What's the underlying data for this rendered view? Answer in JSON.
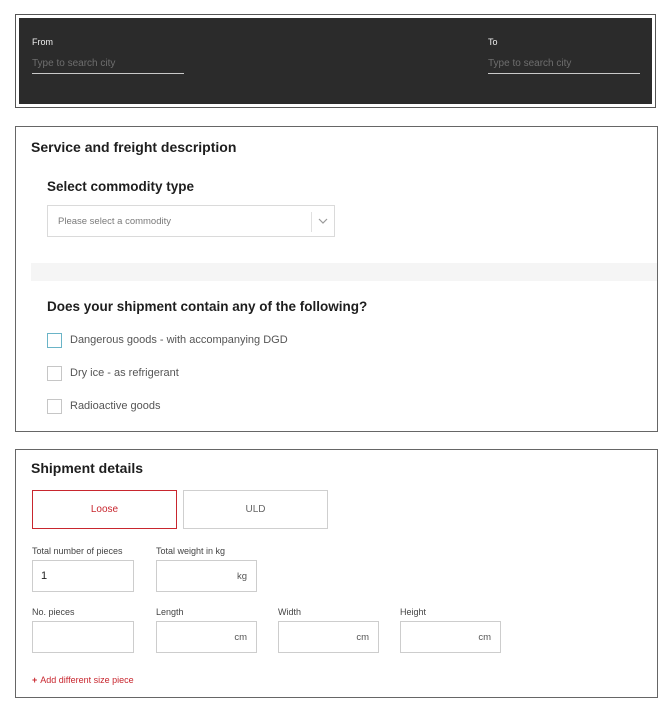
{
  "route": {
    "from_label": "From",
    "from_placeholder": "Type to search city",
    "to_label": "To",
    "to_placeholder": "Type to search city"
  },
  "service": {
    "title": "Service and freight description",
    "commodity_heading": "Select commodity type",
    "commodity_placeholder": "Please select a commodity",
    "commodity_icon": "chevron-down-icon",
    "goods_heading": "Does your shipment contain any of the following?",
    "options": [
      {
        "label": "Dangerous goods - with accompanying DGD",
        "checked": false
      },
      {
        "label": "Dry ice - as refrigerant",
        "checked": false
      },
      {
        "label": "Radioactive goods",
        "checked": false
      }
    ]
  },
  "shipment": {
    "title": "Shipment details",
    "tabs": {
      "loose": "Loose",
      "uld": "ULD",
      "selected": "Loose"
    },
    "total_pieces_label": "Total number of pieces",
    "total_pieces_value": "1",
    "total_weight_label": "Total weight in kg",
    "total_weight_unit": "kg",
    "no_pieces_label": "No. pieces",
    "length_label": "Length",
    "width_label": "Width",
    "height_label": "Height",
    "dim_unit": "cm",
    "add_piece_icon": "+",
    "add_piece_label": "Add different size piece"
  },
  "colors": {
    "accent": "#c8262e",
    "dark_panel": "#2b2b2b",
    "focus": "#6ab4c7"
  }
}
